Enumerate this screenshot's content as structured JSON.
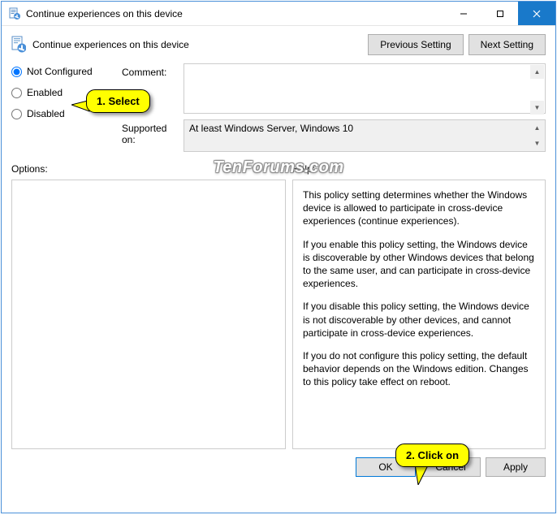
{
  "window": {
    "title": "Continue experiences on this device"
  },
  "header": {
    "policy_title": "Continue experiences on this device",
    "prev_button": "Previous Setting",
    "next_button": "Next Setting"
  },
  "config": {
    "radios": {
      "not_configured": "Not Configured",
      "enabled": "Enabled",
      "disabled": "Disabled",
      "selected": "not_configured"
    },
    "comment_label": "Comment:",
    "comment_value": "",
    "supported_label": "Supported on:",
    "supported_value": "At least Windows Server, Windows 10"
  },
  "lower": {
    "options_label": "Options:",
    "help_label": "Help:",
    "help_text": {
      "p1": "This policy setting determines whether the Windows device is allowed to participate in cross-device experiences (continue experiences).",
      "p2": "If you enable this policy setting, the Windows device is discoverable by other Windows devices that belong to the same user, and can participate in cross-device experiences.",
      "p3": "If you disable this policy setting, the Windows device is not discoverable by other devices, and cannot participate in cross-device experiences.",
      "p4": "If you do not configure this policy setting, the default behavior depends on the Windows edition. Changes to this policy take effect on reboot."
    }
  },
  "footer": {
    "ok": "OK",
    "cancel": "Cancel",
    "apply": "Apply"
  },
  "callouts": {
    "select": "1. Select",
    "click_on": "2. Click on"
  },
  "watermark": "TenForums.com"
}
